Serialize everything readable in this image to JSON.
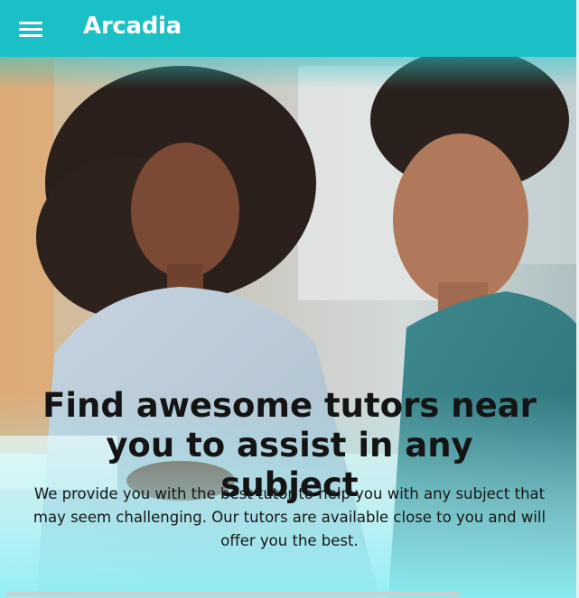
{
  "app": {
    "brand": "Arcadia"
  },
  "nav": {
    "menu_icon": "hamburger-menu-icon"
  },
  "hero": {
    "title": "Find awesome tutors near you to assist in any subject",
    "subtitle": "We provide you with the best tutor to help you with any subject that may seem challenging. Our tutors are available close to you and will offer you the best."
  },
  "colors": {
    "topbar": "#1bbfc6",
    "text": "#141414",
    "fade": "#8ef0f5"
  }
}
